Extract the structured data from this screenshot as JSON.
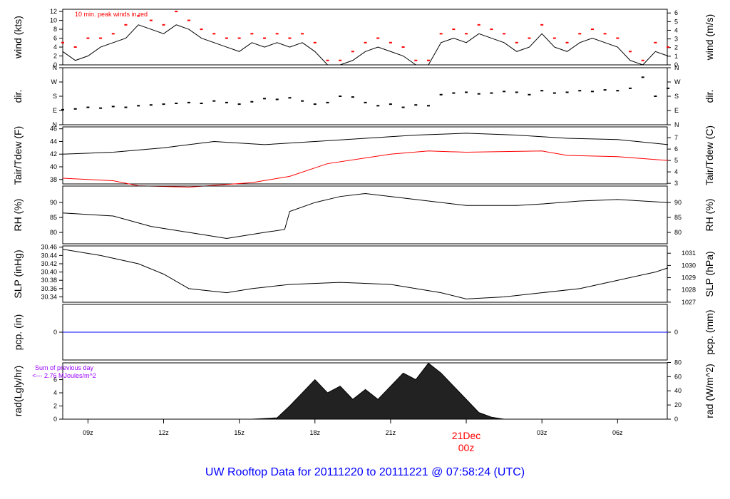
{
  "chart_data": {
    "type": "line",
    "title": "UW Rooftop Data for 20111220  to  20111221 @ 07:58:24  (UTC)",
    "x_unit": "hours UTC from 20111220 00z",
    "xlim": [
      8.0,
      31.97
    ],
    "x_ticks": [
      {
        "t": 9,
        "label": "09z"
      },
      {
        "t": 12,
        "label": "12z"
      },
      {
        "t": 15,
        "label": "15z"
      },
      {
        "t": 18,
        "label": "18z"
      },
      {
        "t": 21,
        "label": "21z"
      },
      {
        "t": 24,
        "label": "00z",
        "date": "21Dec"
      },
      {
        "t": 27,
        "label": "03z"
      },
      {
        "t": 30,
        "label": "06z"
      }
    ],
    "panels": [
      {
        "id": "wind",
        "ylabel": "wind (kts)",
        "ylabel_right": "wind (m/s)",
        "ylim": [
          0,
          12.5
        ],
        "yticks": [
          0,
          2,
          4,
          6,
          8,
          10,
          12
        ],
        "right_ticks": [
          0,
          1,
          2,
          3,
          4,
          5,
          6
        ],
        "right_factor": 1.944,
        "annotation": "10 min. peak winds in red",
        "x": [
          8,
          8.5,
          9,
          9.5,
          10,
          10.5,
          11,
          11.5,
          12,
          12.5,
          13,
          13.5,
          14,
          14.5,
          15,
          15.5,
          16,
          16.5,
          17,
          17.5,
          18,
          18.5,
          19,
          19.5,
          20,
          20.5,
          21,
          21.5,
          22,
          22.5,
          23,
          23.5,
          24,
          24.5,
          25,
          25.5,
          26,
          26.5,
          27,
          27.5,
          28,
          28.5,
          29,
          29.5,
          30,
          30.5,
          31,
          31.5,
          32
        ],
        "y": [
          3,
          1,
          2,
          4,
          5,
          6,
          9,
          8,
          7,
          9,
          8,
          6,
          5,
          4,
          3,
          5,
          4,
          5,
          4,
          5,
          3,
          0,
          0,
          1,
          3,
          4,
          3,
          2,
          0,
          0,
          5,
          6,
          5,
          7,
          6,
          5,
          3,
          4,
          7,
          4,
          3,
          5,
          6,
          5,
          4,
          1,
          0,
          3,
          2
        ],
        "gust": [
          5,
          4,
          6,
          6,
          7,
          9,
          11,
          10,
          9,
          12,
          10,
          8,
          7,
          6,
          6,
          7,
          6,
          7,
          6,
          7,
          5,
          1,
          1,
          3,
          5,
          6,
          5,
          4,
          1,
          1,
          7,
          8,
          7,
          9,
          8,
          7,
          5,
          6,
          9,
          6,
          5,
          7,
          8,
          7,
          6,
          3,
          1,
          5,
          4
        ]
      },
      {
        "id": "dir",
        "ylabel": "dir.",
        "ylabel_right": "dir.",
        "ylim": [
          0,
          360
        ],
        "yticks": [
          0,
          90,
          180,
          270,
          360
        ],
        "tick_labels": [
          "N",
          "E",
          "S",
          "W",
          "N"
        ],
        "x": [
          8,
          8.5,
          9,
          9.5,
          10,
          10.5,
          11,
          11.5,
          12,
          12.5,
          13,
          13.5,
          14,
          14.5,
          15,
          15.5,
          16,
          16.5,
          17,
          17.5,
          18,
          18.5,
          19,
          19.5,
          20,
          20.5,
          21,
          21.5,
          22,
          22.5,
          23,
          23.5,
          24,
          24.5,
          25,
          25.5,
          26,
          26.5,
          27,
          27.5,
          28,
          28.5,
          29,
          29.5,
          30,
          30.5,
          31,
          31.5,
          32
        ],
        "y": [
          95,
          100,
          110,
          105,
          115,
          110,
          120,
          125,
          130,
          135,
          140,
          135,
          150,
          140,
          130,
          145,
          165,
          160,
          170,
          150,
          130,
          140,
          180,
          175,
          140,
          120,
          130,
          110,
          125,
          120,
          190,
          200,
          205,
          195,
          200,
          210,
          205,
          190,
          215,
          200,
          205,
          215,
          210,
          220,
          215,
          230,
          300,
          180,
          230
        ]
      },
      {
        "id": "temp",
        "ylabel": "Tair/Tdew (F)",
        "ylabel_right": "Tair/Tdew (C)",
        "ylim": [
          37.3,
          46.3
        ],
        "yticks": [
          38,
          40,
          42,
          44,
          46
        ],
        "right_ticks": [
          3,
          4,
          5,
          6,
          7
        ],
        "series": [
          {
            "name": "Tair",
            "color": "#000000",
            "x": [
              8,
              10,
              12,
              14,
              16,
              18,
              20,
              22,
              24,
              26,
              28,
              30,
              32
            ],
            "y": [
              42,
              42.3,
              43,
              44,
              43.5,
              44,
              44.5,
              45,
              45.3,
              45,
              44.5,
              44.3,
              43.5
            ]
          },
          {
            "name": "Tdew",
            "color": "#ff0000",
            "x": [
              8,
              10,
              11,
              13,
              15.5,
              17,
              18.5,
              21,
              22.5,
              24,
              27,
              28,
              30,
              32
            ],
            "y": [
              38.2,
              37.8,
              37,
              36.8,
              37.5,
              38.5,
              40.5,
              42,
              42.5,
              42.3,
              42.5,
              41.8,
              41.6,
              41
            ]
          }
        ]
      },
      {
        "id": "rh",
        "ylabel": "RH (%)",
        "ylabel_right": "RH (%)",
        "ylim": [
          76.2,
          95.5
        ],
        "yticks": [
          80,
          85,
          90
        ],
        "right_ticks": [
          80,
          85,
          90
        ],
        "x": [
          8,
          10,
          11.5,
          13,
          14.5,
          16,
          16.8,
          17,
          18,
          19,
          20,
          22,
          24,
          26,
          27,
          28.5,
          30,
          32
        ],
        "y": [
          86.5,
          85.5,
          82,
          80,
          78,
          80,
          81,
          87,
          90,
          92,
          93,
          91,
          89,
          89,
          89.5,
          90.5,
          91,
          90
        ]
      },
      {
        "id": "slp",
        "ylabel": "SLP (inHg)",
        "ylabel_right": "SLP (hPa)",
        "ylim": [
          30.327,
          30.463
        ],
        "yticks": [
          30.34,
          30.36,
          30.38,
          30.4,
          30.42,
          30.44,
          30.46
        ],
        "right_ticks": [
          1027,
          1028,
          1029,
          1030,
          1031
        ],
        "x": [
          8,
          9.5,
          11,
          12,
          13,
          14.5,
          15.5,
          17,
          19,
          21,
          23,
          24,
          25.5,
          27,
          28.5,
          30,
          31.5,
          32
        ],
        "y": [
          30.455,
          30.44,
          30.42,
          30.395,
          30.36,
          30.35,
          30.36,
          30.37,
          30.375,
          30.37,
          30.35,
          30.335,
          30.34,
          30.35,
          30.36,
          30.38,
          30.4,
          30.41
        ]
      },
      {
        "id": "pcp",
        "ylabel": "pcp. (in)",
        "ylabel_right": "pcp. (mm)",
        "ylim": [
          -1,
          1
        ],
        "yticks": [
          0
        ],
        "right_ticks": [
          0
        ],
        "x": [
          8,
          32
        ],
        "y": [
          0,
          0
        ]
      },
      {
        "id": "rad",
        "ylabel": "rad(Lgly/hr)",
        "ylabel_right": "rad (W/m^2)",
        "ylim": [
          0,
          8.55
        ],
        "yticks": [
          0,
          2,
          4,
          6
        ],
        "right_ticks": [
          0,
          20,
          40,
          60,
          80
        ],
        "right_factor": 0.1076,
        "annotation": "Sum of previous day",
        "annotation2": "<--- 2.76 MJoules/m^2",
        "x": [
          8,
          15.5,
          16.5,
          17,
          17.5,
          18,
          18.5,
          19,
          19.5,
          20,
          20.5,
          21,
          21.5,
          22,
          22.5,
          23,
          23.5,
          24,
          24.5,
          25,
          25.5,
          32
        ],
        "y": [
          0,
          0,
          0.2,
          2,
          4,
          6,
          4,
          5,
          3,
          4.5,
          3,
          5,
          7,
          6,
          8.5,
          7,
          5,
          3,
          1,
          0.3,
          0,
          0
        ]
      }
    ]
  }
}
